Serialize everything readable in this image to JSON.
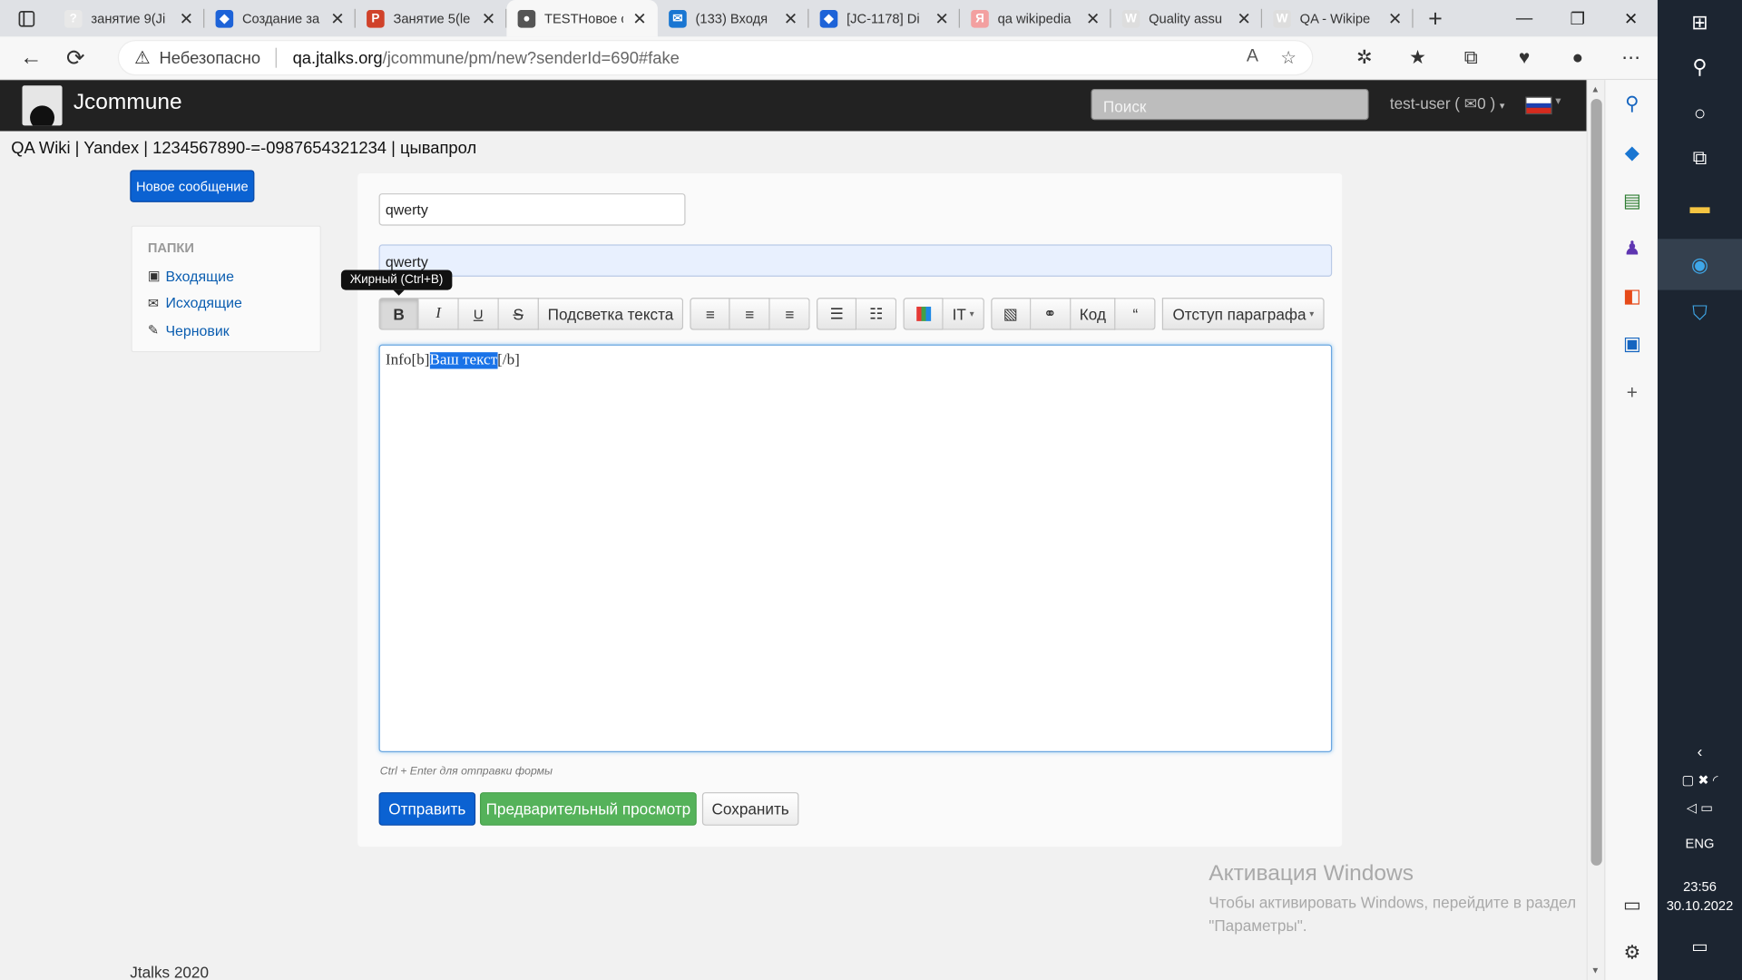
{
  "browser": {
    "tabs": [
      {
        "title": "занятие 9(Ji",
        "icon_color": "#e8e8e8",
        "icon_text": "?"
      },
      {
        "title": "Создание за",
        "icon_color": "#1d63d8",
        "icon_text": "◆"
      },
      {
        "title": "Занятие 5(le",
        "icon_color": "#d0422a",
        "icon_text": "P"
      },
      {
        "title": "TESTНовое с",
        "icon_color": "#555555",
        "icon_text": "●",
        "active": true
      },
      {
        "title": "(133) Входя",
        "icon_color": "#1976d2",
        "icon_text": "✉"
      },
      {
        "title": "[JC-1178] Di",
        "icon_color": "#1d63d8",
        "icon_text": "◆"
      },
      {
        "title": "qa wikipedia",
        "icon_color": "#f3a0a0",
        "icon_text": "Я"
      },
      {
        "title": "Quality assu",
        "icon_color": "#dddddd",
        "icon_text": "W"
      },
      {
        "title": "QA - Wikipe",
        "icon_color": "#dddddd",
        "icon_text": "W"
      }
    ],
    "insecure_label": "Небезопасно",
    "url_host": "qa.jtalks.org",
    "url_path": "/jcommune/pm/new?senderId=690#fake"
  },
  "site": {
    "brand": "Jcommune",
    "search_placeholder": "Поиск",
    "user": "test-user (",
    "user_count": "0 )",
    "links": "QA Wiki | Yandex | 1234567890-=-0987654321234 | цывапрол"
  },
  "sidebar": {
    "new_message": "Новое сообщение",
    "folders_header": "ПАПКИ",
    "folders": [
      {
        "label": "Входящие",
        "icon": "inbox-icon"
      },
      {
        "label": "Исходящие",
        "icon": "envelope-icon"
      },
      {
        "label": "Черновик",
        "icon": "pencil-icon"
      }
    ]
  },
  "form": {
    "recipient": "qwerty",
    "subject": "qwerty",
    "tooltip": "Жирный (Ctrl+B)",
    "toolbar": {
      "bold": "B",
      "italic": "I",
      "underline": "U",
      "strike": "S",
      "highlight": "Подсветка текста",
      "code": "Код",
      "quote": "“",
      "indent": "Отступ параграфа"
    },
    "body_before": "Info[b]",
    "body_selected": "Ваш текст",
    "body_after": "[/b]",
    "hint": "Ctrl + Enter для отправки формы",
    "send": "Отправить",
    "preview": "Предварительный просмотр",
    "save": "Сохранить"
  },
  "watermark": {
    "title": "Активация Windows",
    "text": "Чтобы активировать Windows, перейдите в раздел \"Параметры\"."
  },
  "footer": "Jtalks 2020",
  "taskbar": {
    "lang": "ENG",
    "time": "23:56",
    "date": "30.10.2022"
  }
}
